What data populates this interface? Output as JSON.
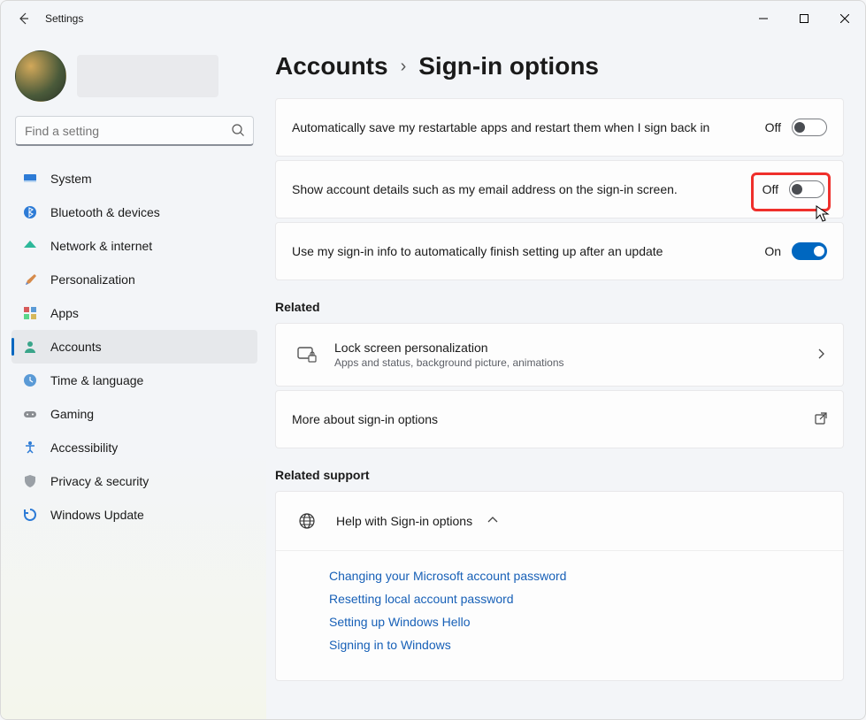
{
  "window": {
    "title": "Settings"
  },
  "search": {
    "placeholder": "Find a setting"
  },
  "nav": [
    {
      "label": "System"
    },
    {
      "label": "Bluetooth & devices"
    },
    {
      "label": "Network & internet"
    },
    {
      "label": "Personalization"
    },
    {
      "label": "Apps"
    },
    {
      "label": "Accounts"
    },
    {
      "label": "Time & language"
    },
    {
      "label": "Gaming"
    },
    {
      "label": "Accessibility"
    },
    {
      "label": "Privacy & security"
    },
    {
      "label": "Windows Update"
    }
  ],
  "breadcrumb": {
    "parent": "Accounts",
    "current": "Sign-in options"
  },
  "settings": [
    {
      "label": "Automatically save my restartable apps and restart them when I sign back in",
      "state": "Off"
    },
    {
      "label": "Show account details such as my email address on the sign-in screen.",
      "state": "Off"
    },
    {
      "label": "Use my sign-in info to automatically finish setting up after an update",
      "state": "On"
    }
  ],
  "related": {
    "heading": "Related",
    "items": [
      {
        "title": "Lock screen personalization",
        "subtitle": "Apps and status, background picture, animations"
      },
      {
        "title": "More about sign-in options"
      }
    ]
  },
  "related_support": {
    "heading": "Related support",
    "help_title": "Help with Sign-in options",
    "links": [
      "Changing your Microsoft account password",
      "Resetting local account password",
      "Setting up Windows Hello",
      "Signing in to Windows"
    ]
  }
}
